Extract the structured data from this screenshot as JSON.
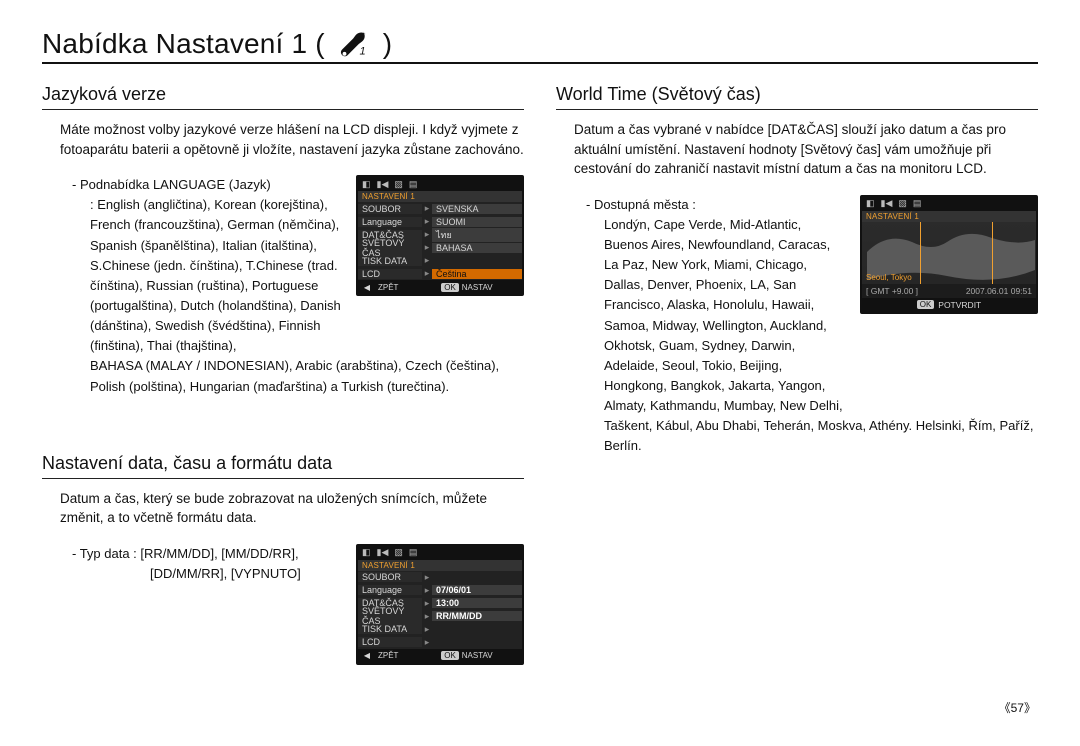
{
  "page": {
    "title_prefix": "Nabídka Nastavení 1 (",
    "title_suffix": ")",
    "number": "57"
  },
  "left": {
    "s1": {
      "header": "Jazyková verze",
      "para": "Máte možnost volby jazykové verze hlášení na LCD displeji. I když vyjmete z fotoaparátu baterii a opětovně ji vložíte, nastavení jazyka zůstane zachováno.",
      "sub_label": "- Podnabídka LANGUAGE (Jazyk)",
      "sub_body1": ": English (angličtina), Korean (korejština), French (francouzština), German (němčina), Spanish (španělština), Italian (italština), S.Chinese (jedn. čínština), T.Chinese (trad. čínština), Russian (ruština), Portuguese (portugalština), Dutch (holandština), Danish (dánština), Swedish (švédština), Finnish (finština), Thai (thajština),",
      "sub_body2": "BAHASA (MALAY / INDONESIAN), Arabic (arabština), Czech (čeština), Polish (polština), Hungarian (maďarština) a Turkish (turečtina)."
    },
    "s2": {
      "header": "Nastavení data, času a formátu data",
      "para": "Datum a čas, který se bude zobrazovat na uložených snímcích, můžete změnit, a to včetně formátu data.",
      "sub_line1": "- Typ data : [RR/MM/DD], [MM/DD/RR],",
      "sub_line2": "[DD/MM/RR], [VYPNUTO]"
    }
  },
  "right": {
    "s1": {
      "header": "World Time (Světový čas)",
      "para": "Datum a čas vybrané v  nabídce [DAT&ČAS] slouží jako datum a čas pro aktuální umístění. Nastavení hodnoty [Světový čas] vám umožňuje při cestování do zahraničí nastavit místní datum a čas na monitoru LCD.",
      "sub_label": "- Dostupná města :",
      "cities1": "Londýn, Cape Verde, Mid-Atlantic, Buenos Aires, Newfoundland, Caracas, La Paz, New York, Miami, Chicago, Dallas, Denver, Phoenix, LA, San Francisco, Alaska, Honolulu, Hawaii, Samoa, Midway, Wellington, Auckland, Okhotsk, Guam, Sydney, Darwin, Adelaide, Seoul, Tokio, Beijing, Hongkong, Bangkok, Jakarta, Yangon, Almaty, Kathmandu, Mumbay, New Delhi,",
      "cities2": "Taškent, Kábul, Abu Dhabi, Teherán, Moskva, Athény. Helsinki, Řím, Paříž, Berlín."
    }
  },
  "lcd_lang": {
    "title": "NASTAVENÍ 1",
    "rows": [
      {
        "lbl": "SOUBOR",
        "val": "SVENSKA"
      },
      {
        "lbl": "Language",
        "val": "SUOMI"
      },
      {
        "lbl": "DAT&ČAS",
        "val": "ไทย"
      },
      {
        "lbl": "SVĚTOVÝ ČAS",
        "val": "BAHASA"
      },
      {
        "lbl": "TISK DATA",
        "val": ""
      },
      {
        "lbl": "LCD",
        "val": "Čeština"
      }
    ],
    "foot_back": "ZPĚT",
    "foot_ok": "OK",
    "foot_set": "NASTAV"
  },
  "lcd_date": {
    "title": "NASTAVENÍ 1",
    "rows": [
      {
        "lbl": "SOUBOR",
        "val": ""
      },
      {
        "lbl": "Language",
        "val": "07/06/01"
      },
      {
        "lbl": "DAT&ČAS",
        "val": "13:00"
      },
      {
        "lbl": "SVĚTOVÝ ČAS",
        "val": "RR/MM/DD"
      },
      {
        "lbl": "TISK DATA",
        "val": ""
      },
      {
        "lbl": "LCD",
        "val": ""
      }
    ],
    "foot_back": "ZPĚT",
    "foot_ok": "OK",
    "foot_set": "NASTAV"
  },
  "lcd_world": {
    "title": "NASTAVENÍ 1",
    "city": "Seoul, Tokyo",
    "gmt": "[ GMT +9.00 ]",
    "stamp": "2007.06.01   09:51",
    "ok": "OK",
    "confirm": "POTVRDIT"
  }
}
